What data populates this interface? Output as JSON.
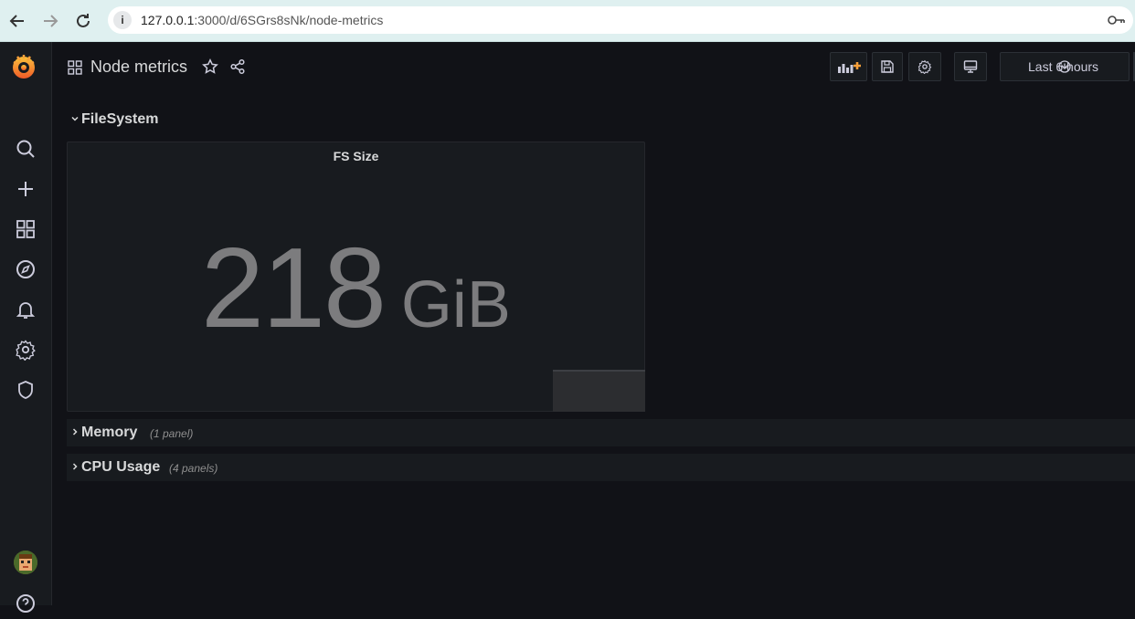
{
  "browser": {
    "url_host": "127.0.0.1",
    "url_path": ":3000/d/6SGrs8sNk/node-metrics"
  },
  "sidebar": {
    "items": [
      "search-icon",
      "plus-icon",
      "dashboards-icon",
      "explore-icon",
      "alerting-icon",
      "configuration-icon",
      "server-admin-icon",
      "help-icon"
    ]
  },
  "header": {
    "title": "Node metrics",
    "time_range": "Last 6 hours"
  },
  "rows": [
    {
      "title": "FileSystem",
      "count": ""
    },
    {
      "title": "Memory",
      "count": "(1 panel)"
    },
    {
      "title": "CPU Usage",
      "count": "(4 panels)"
    }
  ],
  "panel": {
    "title": "FS Size",
    "value": "218",
    "unit": "GiB"
  },
  "colors": {
    "background": "#111217",
    "panel": "#181b1f",
    "stat_text": "#7c7c7e",
    "accent_orange": "#f8a03a"
  }
}
